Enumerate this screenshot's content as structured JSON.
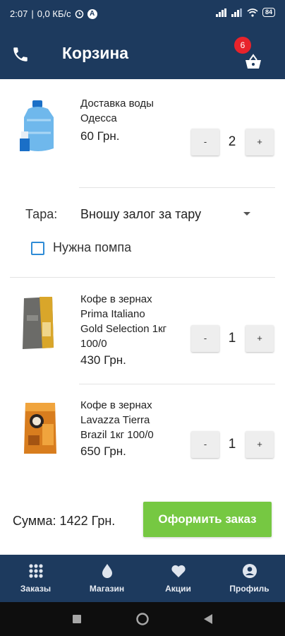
{
  "status_bar": {
    "time": "2:07",
    "speed": "0,0 КБ/с",
    "a_icon_letter": "A",
    "battery": "84"
  },
  "header": {
    "title": "Корзина",
    "cart_count": "6"
  },
  "items": [
    {
      "name_lines": [
        "Доставка воды",
        "Одесса"
      ],
      "price": "60 Грн.",
      "quantity": "2"
    },
    {
      "name_lines": [
        "Кофе в зернах",
        "Prima Italiano",
        "Gold Selection 1кг",
        "100/0"
      ],
      "price": "430 Грн.",
      "quantity": "1"
    },
    {
      "name_lines": [
        "Кофе в зернах",
        "Lavazza Tierra",
        "Brazil 1кг 100/0"
      ],
      "price": "650 Грн.",
      "quantity": "1"
    }
  ],
  "quantity_controls": {
    "minus": "-",
    "plus": "+"
  },
  "container_option": {
    "label": "Тара:",
    "selected": "Вношу залог за тару"
  },
  "pump_option": {
    "label": "Нужна помпа",
    "checked": false
  },
  "footer": {
    "total": "Сумма: 1422 Грн.",
    "order_button": "Оформить заказ"
  },
  "bottom_nav": [
    {
      "label": "Заказы",
      "icon": "grid-icon"
    },
    {
      "label": "Магазин",
      "icon": "water-drop-icon"
    },
    {
      "label": "Акции",
      "icon": "heart-icon"
    },
    {
      "label": "Профиль",
      "icon": "profile-icon"
    }
  ],
  "colors": {
    "primary": "#1d3a5e",
    "accent_green": "#76c842",
    "badge_red": "#e8232b",
    "checkbox_blue": "#2e8bd6"
  }
}
